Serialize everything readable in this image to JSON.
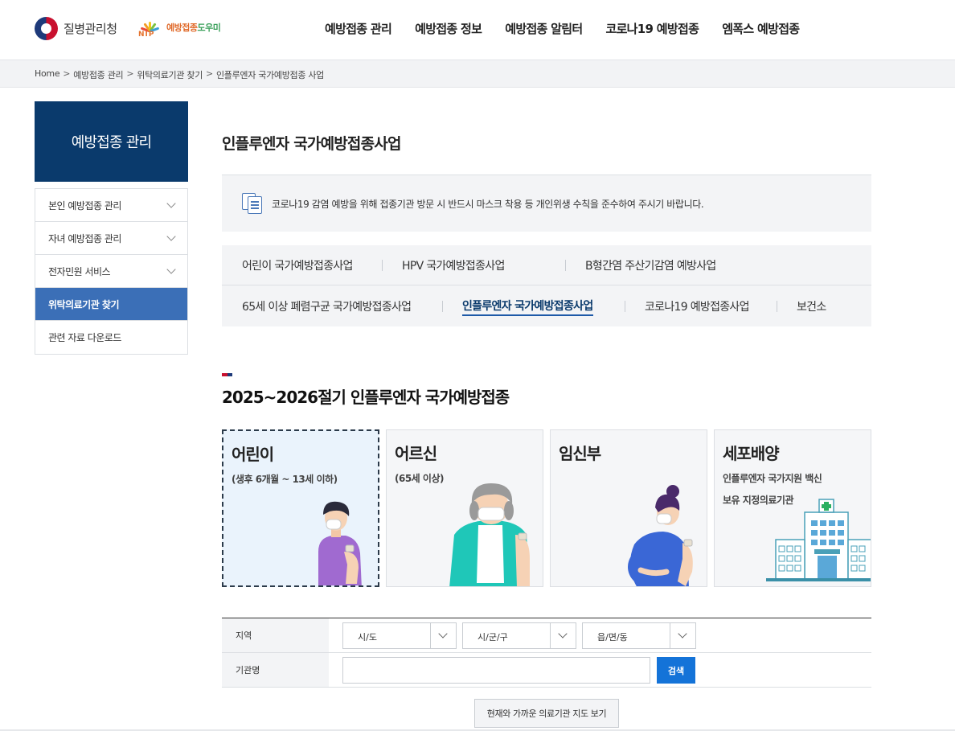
{
  "header": {
    "agency_name": "질병관리청",
    "nip_logo_text": "예방접종",
    "nip_logo_text2": "도우미",
    "nip_letters": "NIP",
    "gnb": [
      "예방접종 관리",
      "예방접종 정보",
      "예방접종 알림터",
      "코로나19 예방접종",
      "엠폭스 예방접종"
    ]
  },
  "breadcrumb": {
    "items": [
      "Home",
      "예방접종 관리",
      "위탁의료기관 찾기",
      "인플루엔자 국가예방접종 사업"
    ],
    "separator": ">"
  },
  "sidebar": {
    "title": "예방접종 관리",
    "items": [
      {
        "label": "본인 예방접종 관리"
      },
      {
        "label": "자녀 예방접종 관리"
      },
      {
        "label": "전자민원 서비스"
      },
      {
        "label": "위탁의료기관 찾기"
      },
      {
        "label": "관련 자료 다운로드"
      }
    ]
  },
  "main": {
    "page_title": "인플루엔자 국가예방접종사업",
    "notice": "코로나19 감염 예방을 위해 접종기관 방문 시 반드시 마스크 착용 등 개인위생 수칙을 준수하여 주시기 바랍니다.",
    "tabs": [
      {
        "label": "어린이 국가예방접종사업"
      },
      {
        "label": "HPV 국가예방접종사업"
      },
      {
        "label": "B형간염 주산기감염 예방사업"
      },
      {
        "label": "65세 이상 폐렴구균 국가예방접종사업"
      },
      {
        "label": "인플루엔자 국가예방접종사업"
      },
      {
        "label": "코로나19 예방접종사업"
      },
      {
        "label": "보건소"
      }
    ],
    "active_tab": "인플루엔자 국가예방접종사업",
    "section_title": "2025~2026절기 인플루엔자 국가예방접종",
    "cards": [
      {
        "title": "어린이",
        "sub": "(생후 6개월 ~ 13세 이하)"
      },
      {
        "title": "어르신",
        "sub": "(65세 이상)"
      },
      {
        "title": "임신부",
        "sub": ""
      },
      {
        "title": "세포배양",
        "sub": "인플루엔자 국가지원 백신",
        "sub2": "보유 지정의료기관"
      }
    ],
    "active_card": "어린이"
  },
  "search": {
    "region_label": "지역",
    "sido": "시/도",
    "sigungu": "시/군/구",
    "eupmyeondong": "읍/면/동",
    "org_label": "기관명",
    "org_value": "",
    "search_button": "검색",
    "map_button": "현재와 가까운 의료기관 지도 보기"
  },
  "colors": {
    "primary_navy": "#0a3a6c",
    "sidebar_active": "#3b6fb7",
    "search_button": "#1473d8"
  }
}
